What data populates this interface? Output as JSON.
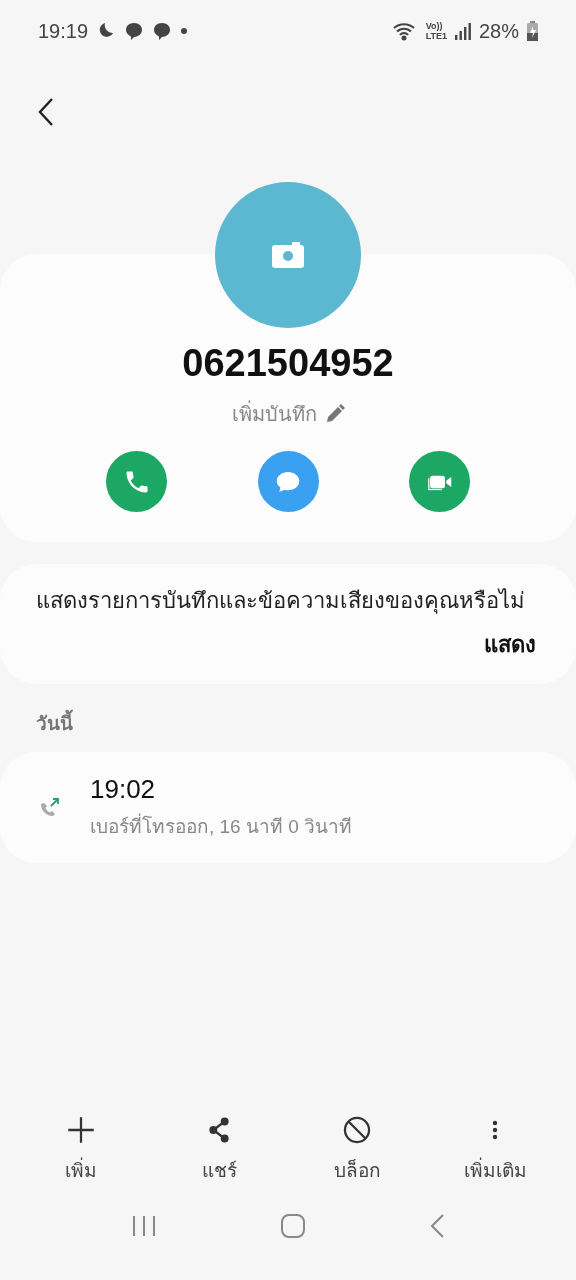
{
  "status_bar": {
    "time": "19:19",
    "volte": "Vo))",
    "lte": "LTE1",
    "battery": "28%"
  },
  "contact": {
    "number": "0621504952",
    "note_label": "เพิ่มบันทึก"
  },
  "actions": [
    {
      "kind": "call"
    },
    {
      "kind": "message"
    },
    {
      "kind": "video"
    }
  ],
  "prompt": {
    "text": "แสดงรายการบันทึกและข้อความเสียงของคุณหรือไม่",
    "button": "แสดง"
  },
  "history": {
    "heading": "วันนี้",
    "entries": [
      {
        "time": "19:02",
        "detail": "เบอร์ที่โทรออก, 16 นาที 0 วินาที",
        "kind": "outgoing"
      }
    ]
  },
  "toolbar": [
    {
      "kind": "add",
      "label": "เพิ่ม"
    },
    {
      "kind": "share",
      "label": "แชร์"
    },
    {
      "kind": "block",
      "label": "บล็อก"
    },
    {
      "kind": "more",
      "label": "เพิ่มเติม"
    }
  ]
}
